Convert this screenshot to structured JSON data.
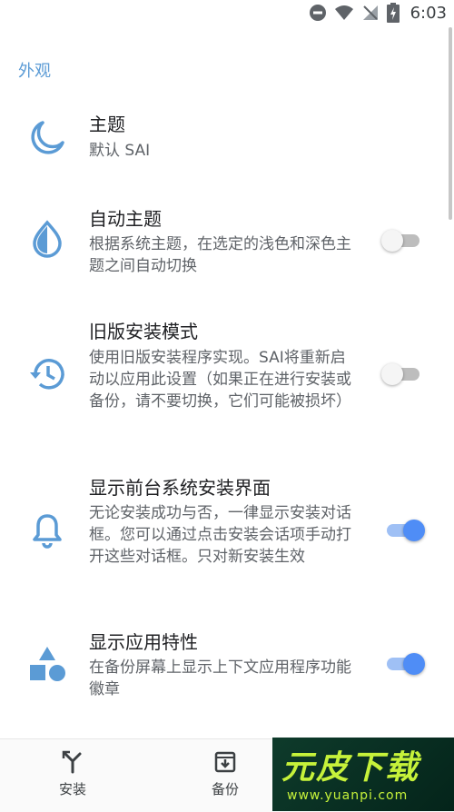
{
  "status_bar": {
    "time": "6:03"
  },
  "section": {
    "title": "外观"
  },
  "preferences": [
    {
      "title": "主题",
      "summary": "默认 SAI",
      "icon": "moon-icon"
    },
    {
      "title": "自动主题",
      "summary": "根据系统主题，在选定的浅色和深色主题之间自动切换",
      "icon": "water-drop-icon",
      "toggle": "off"
    },
    {
      "title": "旧版安装模式",
      "summary": "使用旧版安装程序实现。SAI将重新启动以应用此设置（如果正在进行安装或备份，请不要切换，它们可能被损坏）",
      "icon": "history-icon",
      "toggle": "off"
    },
    {
      "title": "显示前台系统安装界面",
      "summary": "无论安装成功与否，一律显示安装对话框。您可以通过点击安装会话项手动打开这些对话框。只对新安装生效",
      "icon": "bell-icon",
      "toggle": "on"
    },
    {
      "title": "显示应用特性",
      "summary": "在备份屏幕上显示上下文应用程序功能徽章",
      "icon": "shapes-icon",
      "toggle": "on"
    }
  ],
  "bottom_nav": [
    {
      "label": "安装",
      "icon": "install-icon"
    },
    {
      "label": "备份",
      "icon": "archive-icon"
    }
  ],
  "watermark": {
    "text": "元皮下载",
    "url": "www.yuanpi.com"
  },
  "colors": {
    "accent": "#5b9bd5",
    "toggle_on": "#4f8df6",
    "icon": "#5b9bd5"
  }
}
